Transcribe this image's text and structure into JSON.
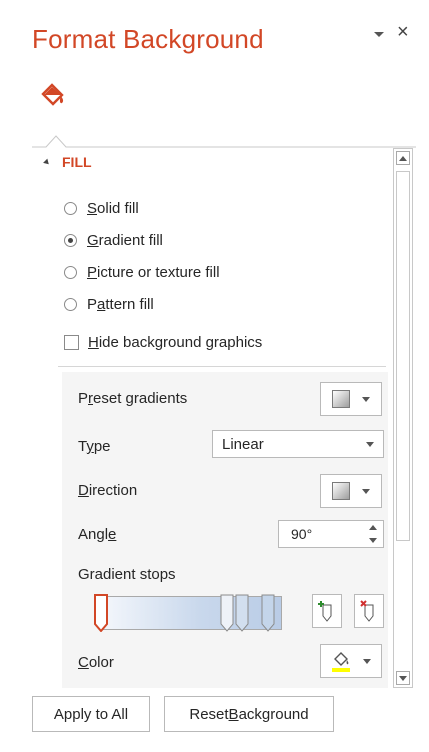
{
  "pane": {
    "title": "Format Background",
    "menu_icon": "chevron-down-icon",
    "close_glyph": "×"
  },
  "tab": {
    "icon": "fill-bucket-icon",
    "selected": true
  },
  "fill": {
    "section_label": "FILL",
    "options": [
      {
        "accel": "S",
        "rest": "olid fill",
        "checked": false
      },
      {
        "accel": "G",
        "rest": "radient fill",
        "checked": true
      },
      {
        "accel": "P",
        "rest": "icture or texture fill",
        "checked": false
      },
      {
        "pre": "P",
        "accel": "a",
        "rest": "ttern fill",
        "checked": false
      }
    ],
    "hide_graphics": {
      "accel": "H",
      "rest": "ide background graphics",
      "checked": false
    }
  },
  "gradient": {
    "preset": {
      "pre": "P",
      "accel": "r",
      "rest": "eset gradients"
    },
    "type": {
      "pre": "T",
      "accel": "y",
      "rest": "pe",
      "value": "Linear"
    },
    "direction": {
      "accel": "D",
      "rest": "irection"
    },
    "angle": {
      "pre": "Angl",
      "accel": "e",
      "rest": "",
      "value": "90°"
    },
    "stops_label": "Gradient stops",
    "color": {
      "accel": "C",
      "rest": "olor"
    }
  },
  "colors": {
    "accent": "#d24726",
    "selected_stop_border": "#d24726",
    "gradient_start": "#f4f7fc",
    "gradient_end": "#b9cce6",
    "font_color_underline": "#ffff00"
  },
  "footer": {
    "apply_all": "Apply to All",
    "reset": {
      "pre": "Reset ",
      "accel": "B",
      "rest": "ackground"
    }
  }
}
